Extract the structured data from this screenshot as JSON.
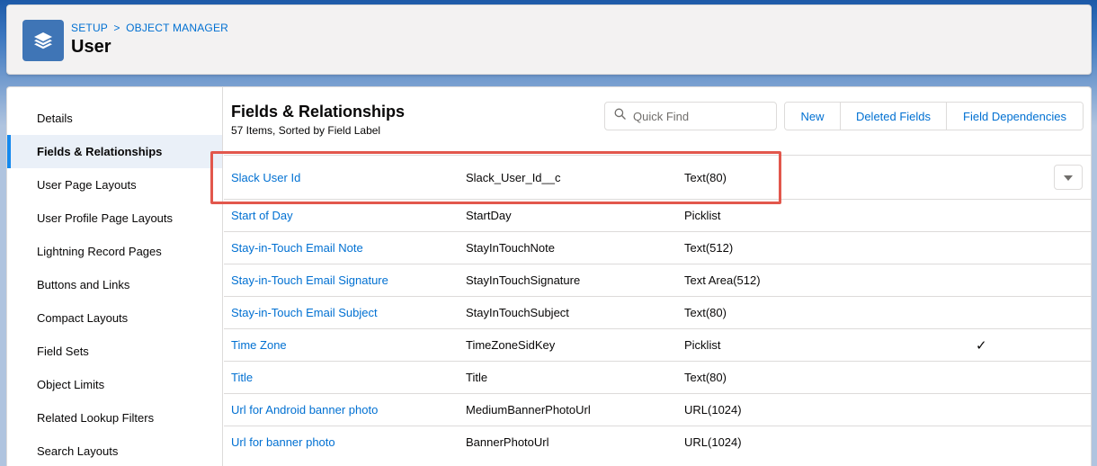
{
  "header": {
    "breadcrumb_setup": "SETUP",
    "breadcrumb_sep": ">",
    "breadcrumb_object_manager": "OBJECT MANAGER",
    "title": "User",
    "icon": "layers-icon"
  },
  "sidebar": {
    "items": [
      {
        "label": "Details"
      },
      {
        "label": "Fields & Relationships",
        "active": true
      },
      {
        "label": "User Page Layouts"
      },
      {
        "label": "User Profile Page Layouts"
      },
      {
        "label": "Lightning Record Pages"
      },
      {
        "label": "Buttons and Links"
      },
      {
        "label": "Compact Layouts"
      },
      {
        "label": "Field Sets"
      },
      {
        "label": "Object Limits"
      },
      {
        "label": "Related Lookup Filters"
      },
      {
        "label": "Search Layouts"
      }
    ]
  },
  "main": {
    "title": "Fields & Relationships",
    "subtitle": "57 Items, Sorted by Field Label",
    "search_placeholder": "Quick Find",
    "search_icon": "search-icon",
    "buttons": {
      "new_label": "New",
      "deleted_fields_label": "Deleted Fields",
      "field_dependencies_label": "Field Dependencies"
    },
    "rows": [
      {
        "label": "Slack User Id",
        "api": "Slack_User_Id__c",
        "type": "Text(80)",
        "indexed": ""
      },
      {
        "label": "Start of Day",
        "api": "StartDay",
        "type": "Picklist",
        "indexed": ""
      },
      {
        "label": "Stay-in-Touch Email Note",
        "api": "StayInTouchNote",
        "type": "Text(512)",
        "indexed": ""
      },
      {
        "label": "Stay-in-Touch Email Signature",
        "api": "StayInTouchSignature",
        "type": "Text Area(512)",
        "indexed": ""
      },
      {
        "label": "Stay-in-Touch Email Subject",
        "api": "StayInTouchSubject",
        "type": "Text(80)",
        "indexed": ""
      },
      {
        "label": "Time Zone",
        "api": "TimeZoneSidKey",
        "type": "Picklist",
        "indexed": "✓"
      },
      {
        "label": "Title",
        "api": "Title",
        "type": "Text(80)",
        "indexed": ""
      },
      {
        "label": "Url for Android banner photo",
        "api": "MediumBannerPhotoUrl",
        "type": "URL(1024)",
        "indexed": ""
      },
      {
        "label": "Url for banner photo",
        "api": "BannerPhotoUrl",
        "type": "URL(1024)",
        "indexed": ""
      }
    ]
  },
  "colors": {
    "link": "#0070d2",
    "highlight": "#e2574c",
    "icon_bg": "#3f75b6",
    "active_bar": "#1589ee"
  }
}
